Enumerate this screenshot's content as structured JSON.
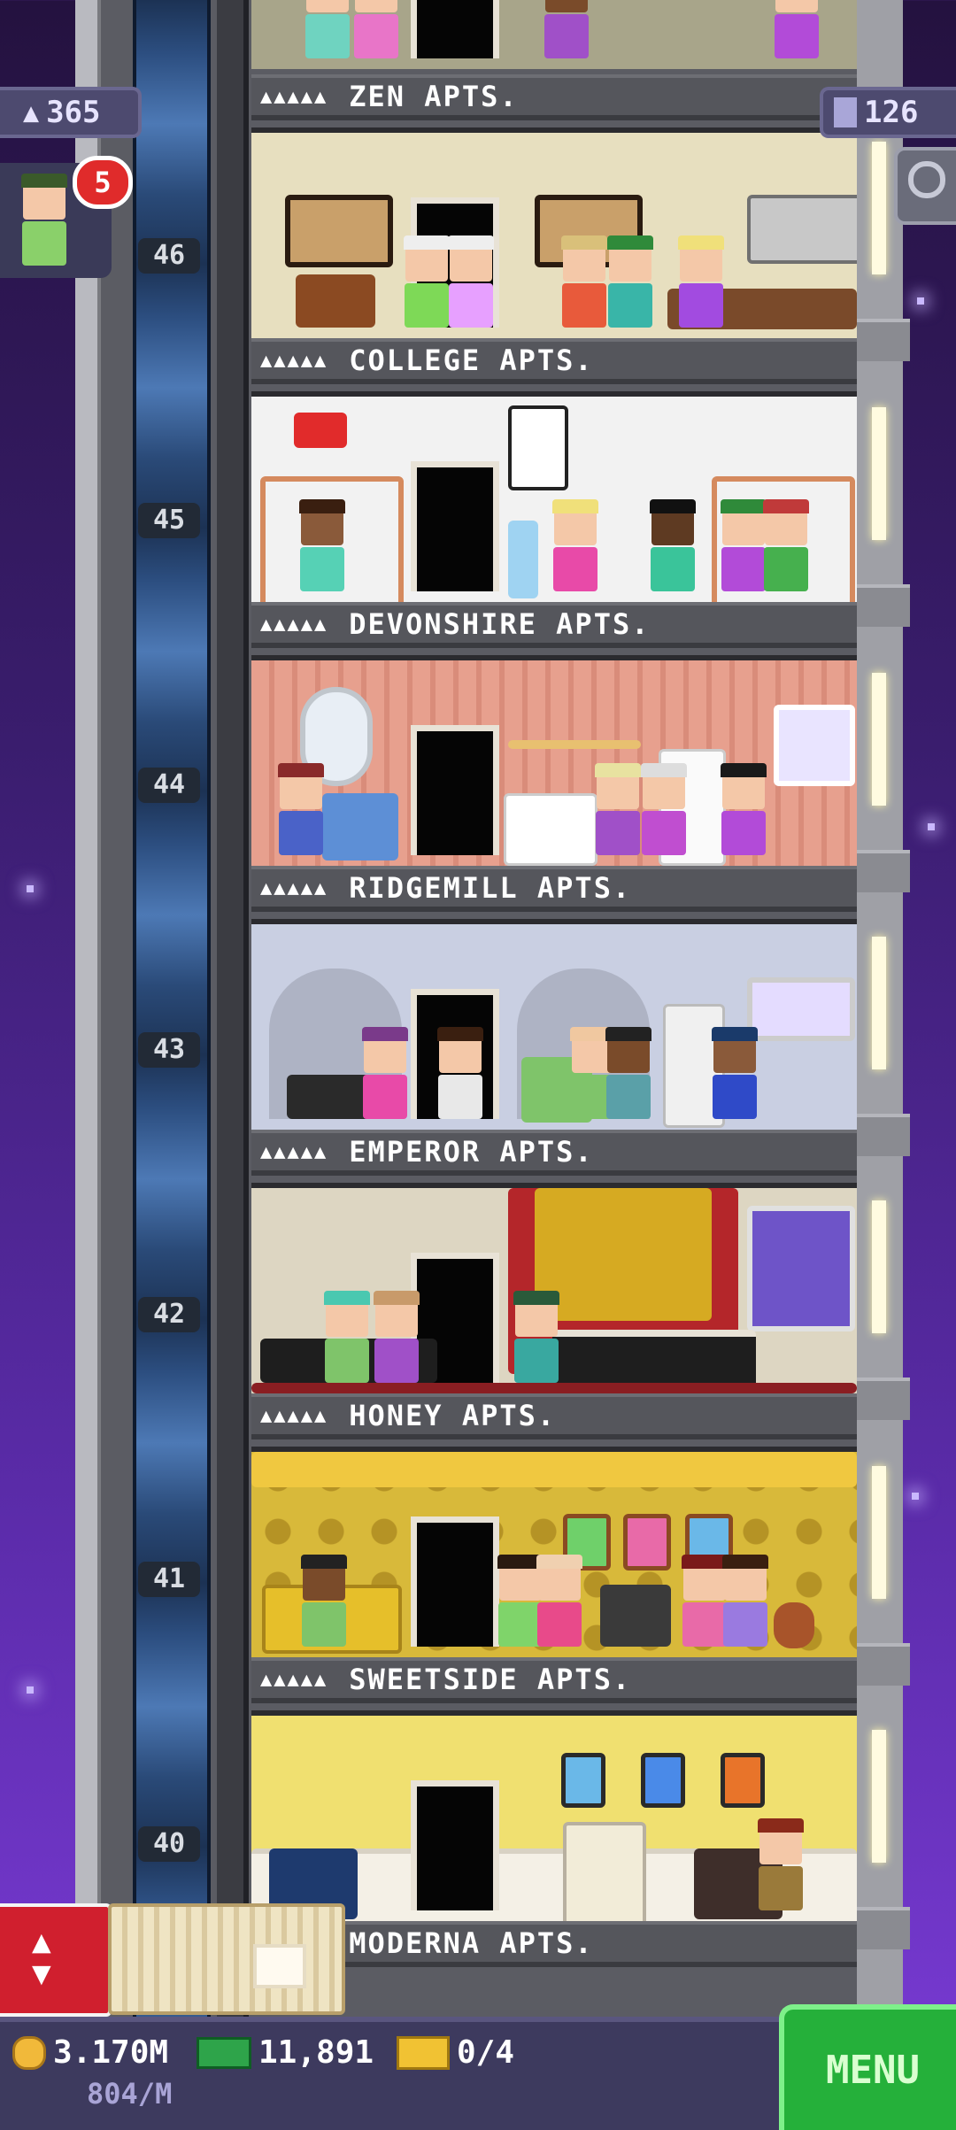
{
  "hud": {
    "population": "365",
    "floors": "126",
    "notification_count": "5"
  },
  "floors": [
    {
      "number": "",
      "name": "ZEN APTS."
    },
    {
      "number": "46",
      "name": "COLLEGE APTS."
    },
    {
      "number": "45",
      "name": "DEVONSHIRE APTS."
    },
    {
      "number": "44",
      "name": "RIDGEMILL APTS."
    },
    {
      "number": "43",
      "name": "EMPEROR APTS."
    },
    {
      "number": "42",
      "name": "HONEY APTS."
    },
    {
      "number": "41",
      "name": "SWEETSIDE APTS."
    },
    {
      "number": "40",
      "name": "MODERNA APTS."
    }
  ],
  "label_dots": "▲▲▲▲▲",
  "bottom": {
    "coins": "3.170M",
    "coin_rate": "804/M",
    "bux": "11,891",
    "tickets": "0/4",
    "menu_label": "MENU"
  },
  "icons": {
    "population": "person-icon",
    "floors": "building-icon",
    "search": "magnifier-icon",
    "elevator": "up-down-arrows-icon",
    "coins": "coin-icon",
    "bux": "bux-bill-icon",
    "tickets": "ticket-icon"
  },
  "colors": {
    "sky_top": "#24123f",
    "sky_bottom": "#7a3bd6",
    "menu_green": "#25b03a",
    "elevator_red": "#d01f2e",
    "badge_red": "#e02b2b"
  }
}
